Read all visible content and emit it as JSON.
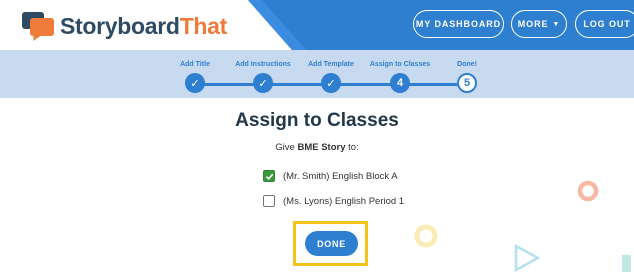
{
  "header": {
    "logo_part1": "Storyboard",
    "logo_part2": "That",
    "buttons": {
      "dashboard": "MY DASHBOARD",
      "more": "MORE",
      "logout": "LOG OUT"
    },
    "colors": {
      "navy": "#2d4b63",
      "orange": "#ef7b3b",
      "blue": "#2f7fd1"
    }
  },
  "wizard": {
    "steps": [
      {
        "label": "Add Title",
        "marker": "✓"
      },
      {
        "label": "Add Instructions",
        "marker": "✓"
      },
      {
        "label": "Add Template",
        "marker": "✓"
      },
      {
        "label": "Assign to Classes",
        "marker": "4"
      },
      {
        "label": "Done!",
        "marker": "5"
      }
    ]
  },
  "main": {
    "title": "Assign to Classes",
    "subtitle_prefix": "Give ",
    "story_name": "BME Story",
    "subtitle_suffix": " to:",
    "classes": [
      {
        "label": "(Mr. Smith) English Block A",
        "checked": true
      },
      {
        "label": "(Ms. Lyons) English Period 1",
        "checked": false
      }
    ],
    "done_label": "DONE"
  }
}
